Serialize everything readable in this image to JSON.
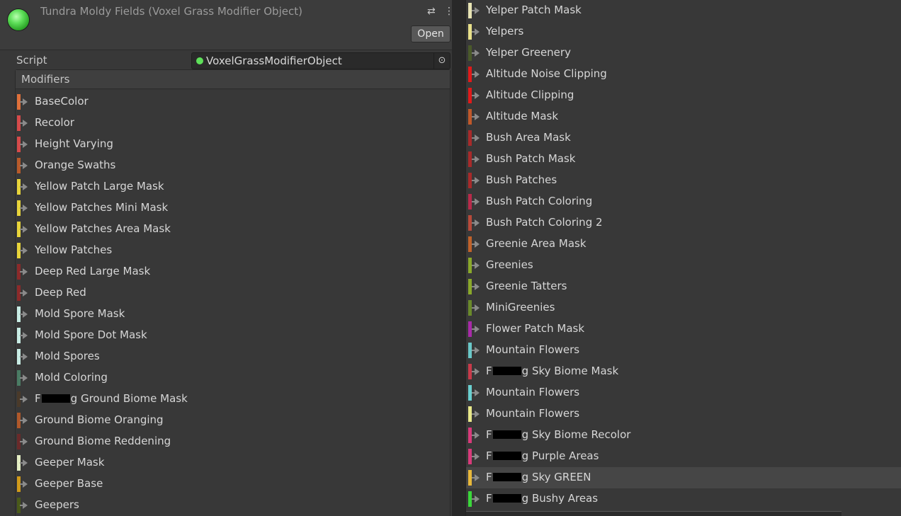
{
  "inspector": {
    "title": "Tundra Moldy Fields (Voxel Grass Modifier Object)",
    "open_label": "Open",
    "script_label": "Script",
    "script_value": "VoxelGrassModifierObject",
    "modifiers_label": "Modifiers",
    "icons": {
      "object": "green-sphere-icon",
      "settings": "sliders-icon",
      "more": "kebab-menu-icon",
      "picker": "target-icon"
    }
  },
  "left_list": [
    {
      "label": "BaseColor",
      "color": "#e0703a"
    },
    {
      "label": "Recolor",
      "color": "#d64a4a"
    },
    {
      "label": "Height Varying",
      "color": "#d64a4a"
    },
    {
      "label": "Orange Swaths",
      "color": "#b85a2a"
    },
    {
      "label": "Yellow Patch Large Mask",
      "color": "#e8d43a"
    },
    {
      "label": "Yellow Patches Mini Mask",
      "color": "#e8d43a"
    },
    {
      "label": "Yellow Patches Area Mask",
      "color": "#e8d43a"
    },
    {
      "label": "Yellow Patches",
      "color": "#e8d43a"
    },
    {
      "label": "Deep Red Large Mask",
      "color": "#8c2a2a"
    },
    {
      "label": "Deep Red",
      "color": "#8c2a2a"
    },
    {
      "label": "Mold Spore Mask",
      "color": "#c8ece4"
    },
    {
      "label": "Mold Spore Dot Mask",
      "color": "#c8ece4"
    },
    {
      "label": "Mold Spores",
      "color": "#c8ece4"
    },
    {
      "label": "Mold Coloring",
      "color": "#4a7c64"
    },
    {
      "label": "Ground Biome Mask",
      "redacted_prefix": "F",
      "redacted_suffix": "g",
      "color": "#4a3a2a"
    },
    {
      "label": "Ground Biome Oranging",
      "color": "#b0582a"
    },
    {
      "label": "Ground Biome Reddening",
      "color": "#6a2a2a"
    },
    {
      "label": "Geeper Mask",
      "color": "#e4eec4"
    },
    {
      "label": "Geeper Base",
      "color": "#d09a1a"
    },
    {
      "label": "Geepers",
      "color": "#4a5a1a"
    }
  ],
  "right_list": [
    {
      "label": "Yelper Patch Mask",
      "color": "#e8e4b4"
    },
    {
      "label": "Yelpers",
      "color": "#e8e08a"
    },
    {
      "label": "Yelper Greenery",
      "color": "#4a5a2a"
    },
    {
      "label": "Altitude Noise Clipping",
      "color": "#e01a1a"
    },
    {
      "label": "Altitude Clipping",
      "color": "#e01a1a"
    },
    {
      "label": "Altitude Mask",
      "color": "#c0582a"
    },
    {
      "label": "Bush Area Mask",
      "color": "#a82a2a"
    },
    {
      "label": "Bush Patch Mask",
      "color": "#a82a2a"
    },
    {
      "label": "Bush Patches",
      "color": "#a82a2a"
    },
    {
      "label": "Bush Patch Coloring",
      "color": "#b82a4a"
    },
    {
      "label": "Bush Patch Coloring 2",
      "color": "#b84a3a"
    },
    {
      "label": "Greenie Area Mask",
      "color": "#c0622a"
    },
    {
      "label": "Greenies",
      "color": "#8aa82a"
    },
    {
      "label": "Greenie Tatters",
      "color": "#8aa82a"
    },
    {
      "label": "MiniGreenies",
      "color": "#6a8a2a"
    },
    {
      "label": "Flower Patch Mask",
      "color": "#a82aa8"
    },
    {
      "label": "Mountain Flowers",
      "color": "#6ac8c8"
    },
    {
      "label": "Sky Biome Mask",
      "redacted_prefix": "F",
      "redacted_suffix": "g",
      "color": "#c83a4a"
    },
    {
      "label": "Mountain Flowers",
      "color": "#6ad0d0"
    },
    {
      "label": "Mountain Flowers",
      "color": "#e8e88a"
    },
    {
      "label": "Sky Biome Recolor",
      "redacted_prefix": "F",
      "redacted_suffix": "g",
      "color": "#d83a7a"
    },
    {
      "label": "Purple Areas",
      "redacted_prefix": "F",
      "redacted_suffix": "g",
      "color": "#d83a7a"
    },
    {
      "label": "Sky GREEN",
      "redacted_prefix": "F",
      "redacted_suffix": "g",
      "color": "#e8b83a",
      "selected": true
    },
    {
      "label": "Bushy Areas",
      "redacted_prefix": "F",
      "redacted_suffix": "g",
      "color": "#3ad83a"
    }
  ]
}
